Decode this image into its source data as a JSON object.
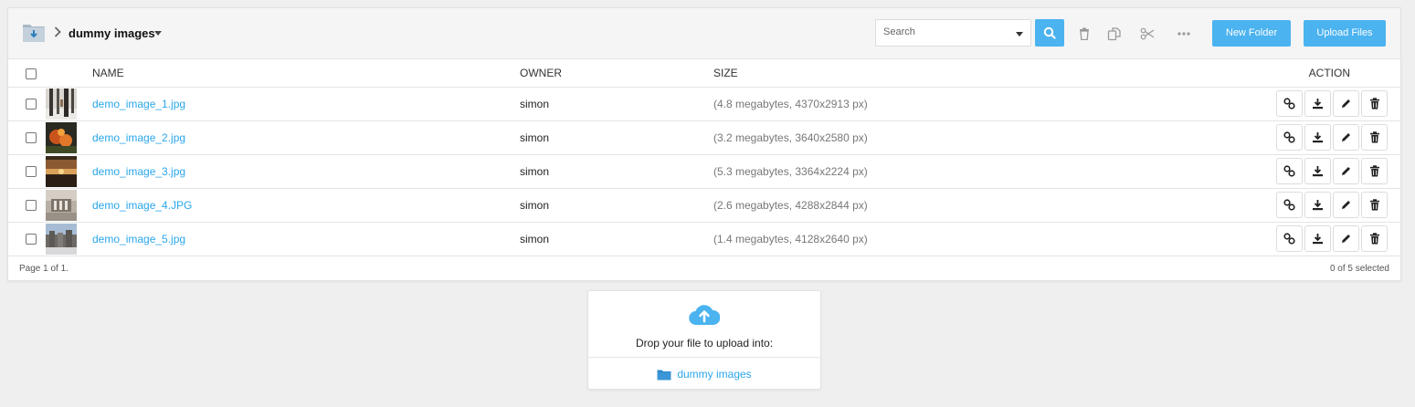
{
  "breadcrumb": {
    "current_folder": "dummy images"
  },
  "toolbar": {
    "search_placeholder": "Search",
    "new_folder_label": "New Folder",
    "upload_files_label": "Upload Files",
    "icons": [
      "search-icon",
      "trash-icon",
      "copy-icon",
      "scissors-icon",
      "more-icon"
    ]
  },
  "table": {
    "headers": {
      "name": "NAME",
      "owner": "OWNER",
      "size": "SIZE",
      "action": "ACTION"
    },
    "rows": [
      {
        "name": "demo_image_1.jpg",
        "owner": "simon",
        "size": "(4.8 megabytes, 4370x2913 px)"
      },
      {
        "name": "demo_image_2.jpg",
        "owner": "simon",
        "size": "(3.2 megabytes, 3640x2580 px)"
      },
      {
        "name": "demo_image_3.jpg",
        "owner": "simon",
        "size": "(5.3 megabytes, 3364x2224 px)"
      },
      {
        "name": "demo_image_4.JPG",
        "owner": "simon",
        "size": "(2.6 megabytes, 4288x2844 px)"
      },
      {
        "name": "demo_image_5.jpg",
        "owner": "simon",
        "size": "(1.4 megabytes, 4128x2640 px)"
      }
    ],
    "row_actions": [
      "link-icon",
      "download-icon",
      "edit-icon",
      "delete-icon"
    ]
  },
  "footer": {
    "pagination": "Page 1 of 1.",
    "selection": "0 of 5 selected"
  },
  "dropzone": {
    "instruction": "Drop your file to upload into:",
    "target_folder": "dummy images"
  },
  "colors": {
    "accent": "#4bb3f0",
    "link": "#2aa6ea",
    "background": "#efefef"
  }
}
